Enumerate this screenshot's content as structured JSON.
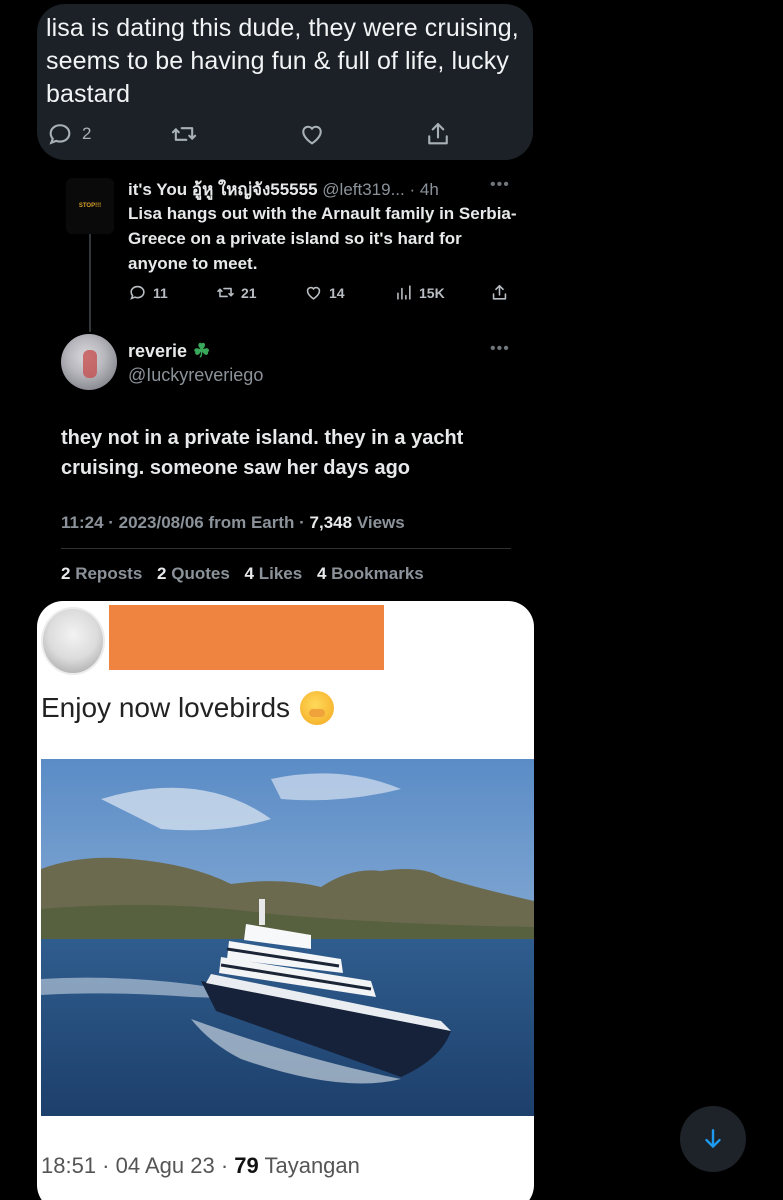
{
  "bubble": {
    "text": "lisa is dating this dude, they were cruising, seems to be having fun & full of life, lucky bastard",
    "reply_count": "2"
  },
  "reply_tweet": {
    "name": "it's You อู้หู ใหญ่จัง55555",
    "handle": "@left319...",
    "age": "· 4h",
    "avatar_text": "STOP!!!",
    "body": "Lisa hangs out with the Arnault family in Serbia-Greece on a private island so it's hard for anyone to meet.",
    "replies": "11",
    "reposts": "21",
    "likes": "14",
    "views": "15K"
  },
  "main_tweet": {
    "name": "reverie",
    "handle": "@Iuckyreveriego",
    "body": "they not in a private island. they in a yacht cruising. someone saw her days ago",
    "time": "11:24 · 2023/08/06 from Earth ·",
    "views_num": "7,348",
    "views_label": "Views",
    "stats": {
      "reposts_num": "2",
      "reposts_label": "Reposts",
      "quotes_num": "2",
      "quotes_label": "Quotes",
      "likes_num": "4",
      "likes_label": "Likes",
      "bookmarks_num": "4",
      "bookmarks_label": "Bookmarks"
    }
  },
  "screenshot_card": {
    "caption": "Enjoy now lovebirds",
    "time": "18:51 · 04 Agu 23 ·",
    "views_num": "79",
    "views_label": "Tayangan"
  },
  "icons": {
    "reply": "reply-icon",
    "repost": "repost-icon",
    "like": "heart-icon",
    "share": "share-icon",
    "views": "views-icon",
    "more": "more-icon",
    "scroll": "arrow-down-icon"
  },
  "colors": {
    "background": "#000000",
    "bubble": "#1b2127",
    "redaction": "#ef8440",
    "scroll_arrow": "#1d9bf0"
  }
}
